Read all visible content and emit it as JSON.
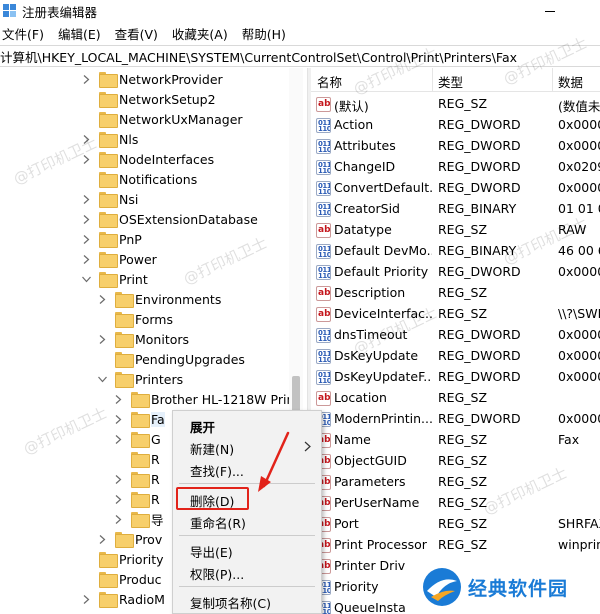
{
  "window": {
    "title": "注册表编辑器"
  },
  "menu": [
    "文件(F)",
    "编辑(E)",
    "查看(V)",
    "收藏夹(A)",
    "帮助(H)"
  ],
  "address": "计算机\\HKEY_LOCAL_MACHINE\\SYSTEM\\CurrentControlSet\\Control\\Print\\Printers\\Fax",
  "tree": [
    {
      "label": "NetworkProvider",
      "level": 0,
      "expander": "collapsed"
    },
    {
      "label": "NetworkSetup2",
      "level": 0,
      "expander": "none"
    },
    {
      "label": "NetworkUxManager",
      "level": 0,
      "expander": "none"
    },
    {
      "label": "Nls",
      "level": 0,
      "expander": "collapsed"
    },
    {
      "label": "NodeInterfaces",
      "level": 0,
      "expander": "collapsed"
    },
    {
      "label": "Notifications",
      "level": 0,
      "expander": "none"
    },
    {
      "label": "Nsi",
      "level": 0,
      "expander": "collapsed"
    },
    {
      "label": "OSExtensionDatabase",
      "level": 0,
      "expander": "collapsed"
    },
    {
      "label": "PnP",
      "level": 0,
      "expander": "collapsed"
    },
    {
      "label": "Power",
      "level": 0,
      "expander": "collapsed"
    },
    {
      "label": "Print",
      "level": 0,
      "expander": "expanded"
    },
    {
      "label": "Environments",
      "level": 1,
      "expander": "collapsed"
    },
    {
      "label": "Forms",
      "level": 1,
      "expander": "none"
    },
    {
      "label": "Monitors",
      "level": 1,
      "expander": "collapsed"
    },
    {
      "label": "PendingUpgrades",
      "level": 1,
      "expander": "none"
    },
    {
      "label": "Printers",
      "level": 1,
      "expander": "expanded"
    },
    {
      "label": "Brother HL-1218W Print",
      "level": 2,
      "expander": "collapsed"
    },
    {
      "label": "Fa",
      "level": 2,
      "expander": "collapsed",
      "selected": true
    },
    {
      "label": "G",
      "level": 2,
      "expander": "collapsed"
    },
    {
      "label": "R",
      "level": 2,
      "expander": "none"
    },
    {
      "label": "R",
      "level": 2,
      "expander": "collapsed"
    },
    {
      "label": "R",
      "level": 2,
      "expander": "collapsed"
    },
    {
      "label": "导",
      "level": 2,
      "expander": "collapsed"
    },
    {
      "label": "Prov",
      "level": 1,
      "expander": "collapsed"
    },
    {
      "label": "Priority",
      "level": 0,
      "expander": "none"
    },
    {
      "label": "Produc",
      "level": 0,
      "expander": "none"
    },
    {
      "label": "RadioM",
      "level": 0,
      "expander": "collapsed"
    }
  ],
  "columns": {
    "name": "名称",
    "type": "类型",
    "data": "数据"
  },
  "values": [
    {
      "name": "(默认)",
      "type": "REG_SZ",
      "data": "(数值未",
      "icon": "str"
    },
    {
      "name": "Action",
      "type": "REG_DWORD",
      "data": "0x0000",
      "icon": "num"
    },
    {
      "name": "Attributes",
      "type": "REG_DWORD",
      "data": "0x0000",
      "icon": "num"
    },
    {
      "name": "ChangeID",
      "type": "REG_DWORD",
      "data": "0x0209",
      "icon": "num"
    },
    {
      "name": "ConvertDefault...",
      "type": "REG_DWORD",
      "data": "0x0000",
      "icon": "num"
    },
    {
      "name": "CreatorSid",
      "type": "REG_BINARY",
      "data": "01 01 0",
      "icon": "num"
    },
    {
      "name": "Datatype",
      "type": "REG_SZ",
      "data": "RAW",
      "icon": "str"
    },
    {
      "name": "Default DevMo...",
      "type": "REG_BINARY",
      "data": "46 00 6",
      "icon": "num"
    },
    {
      "name": "Default Priority",
      "type": "REG_DWORD",
      "data": "0x0000",
      "icon": "num"
    },
    {
      "name": "Description",
      "type": "REG_SZ",
      "data": "",
      "icon": "str"
    },
    {
      "name": "DeviceInterfac...",
      "type": "REG_SZ",
      "data": "\\\\?\\SWI",
      "icon": "str"
    },
    {
      "name": "dnsTimeout",
      "type": "REG_DWORD",
      "data": "0x0000",
      "icon": "num"
    },
    {
      "name": "DsKeyUpdate",
      "type": "REG_DWORD",
      "data": "0x0000",
      "icon": "num"
    },
    {
      "name": "DsKeyUpdateF...",
      "type": "REG_DWORD",
      "data": "0x0000",
      "icon": "num"
    },
    {
      "name": "Location",
      "type": "REG_SZ",
      "data": "",
      "icon": "str"
    },
    {
      "name": "ModernPrintin...",
      "type": "REG_DWORD",
      "data": "0x0000",
      "icon": "num"
    },
    {
      "name": "Name",
      "type": "REG_SZ",
      "data": "Fax",
      "icon": "str"
    },
    {
      "name": "ObjectGUID",
      "type": "REG_SZ",
      "data": "",
      "icon": "str"
    },
    {
      "name": "Parameters",
      "type": "REG_SZ",
      "data": "",
      "icon": "str"
    },
    {
      "name": "PerUserName",
      "type": "REG_SZ",
      "data": "",
      "icon": "str"
    },
    {
      "name": "Port",
      "type": "REG_SZ",
      "data": "SHRFAX",
      "icon": "str"
    },
    {
      "name": "Print Processor",
      "type": "REG_SZ",
      "data": "winprin",
      "icon": "str"
    },
    {
      "name": "Printer Driv",
      "type": "REG_SZ",
      "data": "Mi",
      "icon": "str"
    },
    {
      "name": "Priority",
      "type": "",
      "data": "",
      "icon": "num"
    },
    {
      "name": "QueueInsta",
      "type": "",
      "data": "",
      "icon": "num"
    }
  ],
  "context_menu": {
    "expand": "展开",
    "new": "新建(N)",
    "find": "查找(F)...",
    "delete": "删除(D)",
    "rename": "重命名(R)",
    "export": "导出(E)",
    "permissions": "权限(P)...",
    "copy_key_name": "复制项名称(C)"
  },
  "watermark_text": "@打印机卫士",
  "brand": {
    "name": "经典软件园"
  },
  "colors": {
    "highlight": "#e2231a",
    "selection": "#e5f0fb",
    "brand": "#1a7bd6"
  }
}
